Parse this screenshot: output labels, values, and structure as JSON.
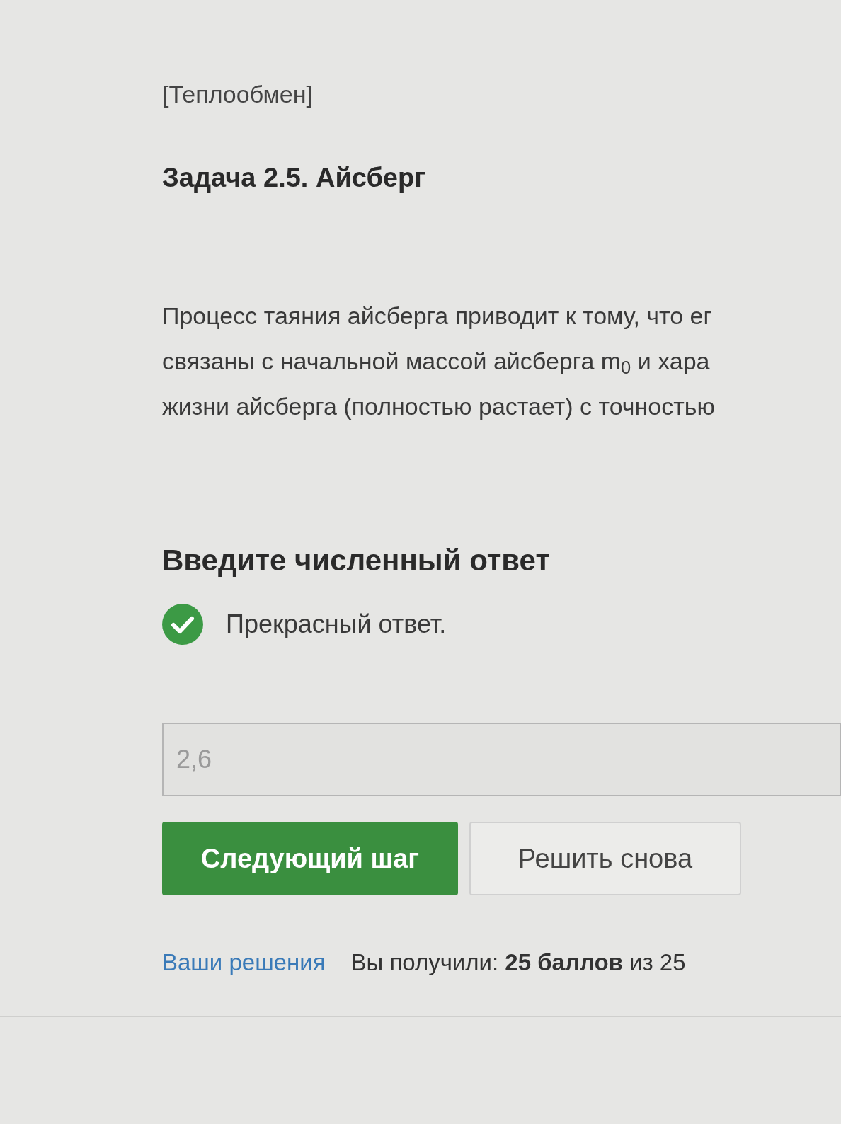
{
  "category": "[Теплообмен]",
  "title": "Задача 2.5. Айсберг",
  "paragraph_lines": [
    "Процесс таяния айсберга приводит к тому, что ег",
    "связаны с начальной массой айсберга m$_{0}$ и хара",
    "жизни айсберга (полностью растает) с точностью"
  ],
  "answer_heading": "Введите численный ответ",
  "feedback": {
    "correct": true,
    "text": "Прекрасный ответ."
  },
  "answer_field": {
    "value": "2,6",
    "disabled": true
  },
  "buttons": [
    {
      "label": "Следующий шаг",
      "kind": "primary"
    },
    {
      "label": "Решить снова",
      "kind": "secondary"
    }
  ],
  "footer": {
    "link": "Ваши решения",
    "score": "Вы получили: **25 баллов** из 25"
  }
}
